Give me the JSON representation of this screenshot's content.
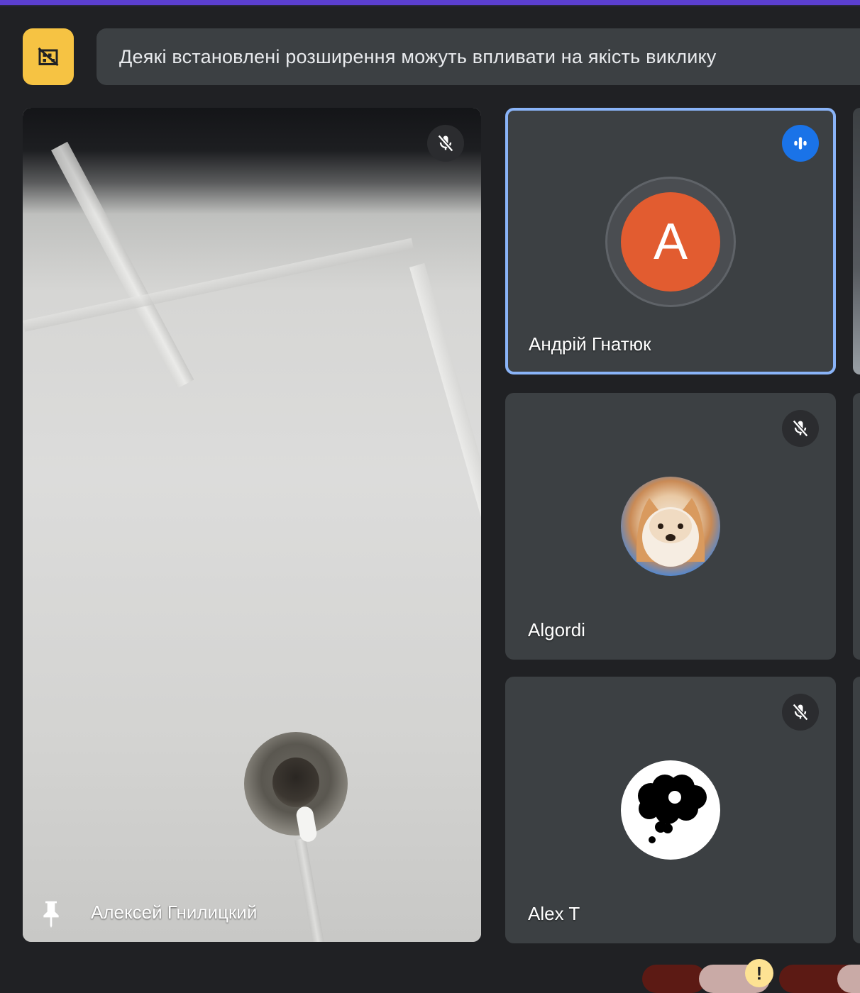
{
  "banner": {
    "message": "Деякі встановлені розширення можуть впливати на якість виклику",
    "icon": "extensions-off-icon",
    "icon_bg": "#f6c343"
  },
  "main_participant": {
    "name": "Алексей Гнилицкий",
    "mic": "muted",
    "pin_icon": "pin-icon"
  },
  "participants": [
    {
      "name": "Андрій Гнатюк",
      "avatar_letter": "A",
      "avatar_color": "#e25c30",
      "status": "speaking",
      "highlight": "#8ab4f8"
    },
    {
      "name": "Algordi",
      "avatar": "dog-photo",
      "mic": "muted"
    },
    {
      "name": "Alex T",
      "avatar": "thought-bubble-picture",
      "mic": "muted"
    }
  ],
  "warning_badge": "!",
  "colors": {
    "background": "#202124",
    "tile": "#3c4043",
    "accent_bar": "#5b3fd0",
    "speaking": "#1a73e8"
  }
}
